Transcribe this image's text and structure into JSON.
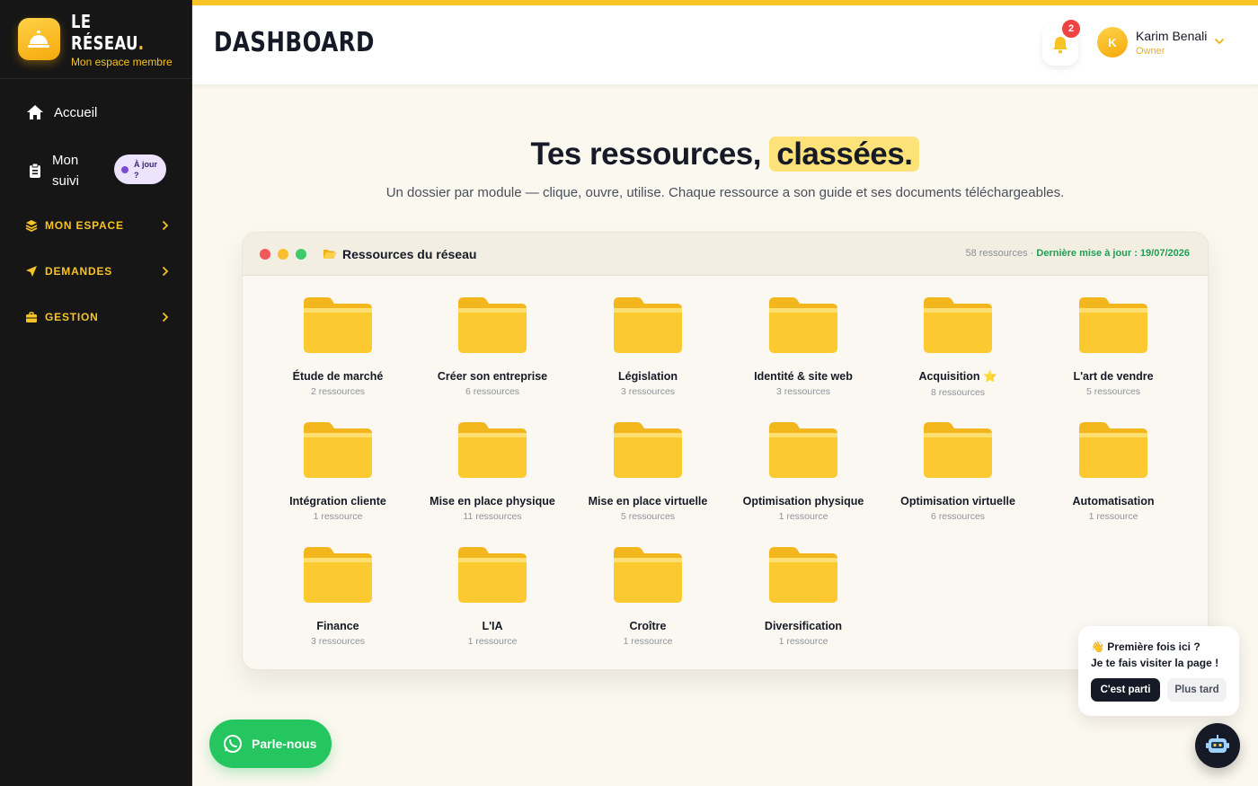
{
  "brand": {
    "name": "LE RÉSEAU",
    "name_dot": ".",
    "subtitle": "Mon espace membre"
  },
  "sidebar": {
    "accueil": "Accueil",
    "suivi_line1": "Mon",
    "suivi_line2": "suivi",
    "suivi_badge": "À jour ?",
    "groups": [
      "MON ESPACE",
      "DEMANDES",
      "GESTION"
    ]
  },
  "header": {
    "title": "DASHBOARD",
    "notifications": "2",
    "user": {
      "initial": "K",
      "name": "Karim Benali",
      "role": "Owner"
    }
  },
  "hero": {
    "title_start": "Tes ressources,",
    "title_highlight": "classées.",
    "subtitle": "Un dossier par module — clique, ouvre, utilise. Chaque ressource a son guide et ses documents téléchargeables."
  },
  "panel": {
    "title": "Ressources du réseau",
    "count": "58 ressources",
    "separator": "·",
    "updated": "Dernière mise à jour : 19/07/2026",
    "folders": [
      {
        "name": "Étude de marché",
        "count": "2 ressources"
      },
      {
        "name": "Créer son entreprise",
        "count": "6 ressources"
      },
      {
        "name": "Législation",
        "count": "3 ressources"
      },
      {
        "name": "Identité & site web",
        "count": "3 ressources"
      },
      {
        "name": "Acquisition ⭐",
        "count": "8 ressources"
      },
      {
        "name": "L'art de vendre",
        "count": "5 ressources"
      },
      {
        "name": "Intégration cliente",
        "count": "1 ressource"
      },
      {
        "name": "Mise en place physique",
        "count": "11 ressources"
      },
      {
        "name": "Mise en place virtuelle",
        "count": "5 ressources"
      },
      {
        "name": "Optimisation physique",
        "count": "1 ressource"
      },
      {
        "name": "Optimisation virtuelle",
        "count": "6 ressources"
      },
      {
        "name": "Automatisation",
        "count": "1 ressource"
      },
      {
        "name": "Finance",
        "count": "3 ressources"
      },
      {
        "name": "L'IA",
        "count": "1 ressource"
      },
      {
        "name": "Croître",
        "count": "1 ressource"
      },
      {
        "name": "Diversification",
        "count": "1 ressource"
      }
    ]
  },
  "widgets": {
    "whatsapp": "Parle-nous",
    "tour_line1": "👋 Première fois ici ?",
    "tour_line2": "Je te fais visiter la page !",
    "tour_go": "C'est parti",
    "tour_later": "Plus tard"
  },
  "colors": {
    "accent": "#f7c325",
    "sidebar": "#161616",
    "success": "#1e9e55",
    "whatsapp": "#25c560"
  }
}
